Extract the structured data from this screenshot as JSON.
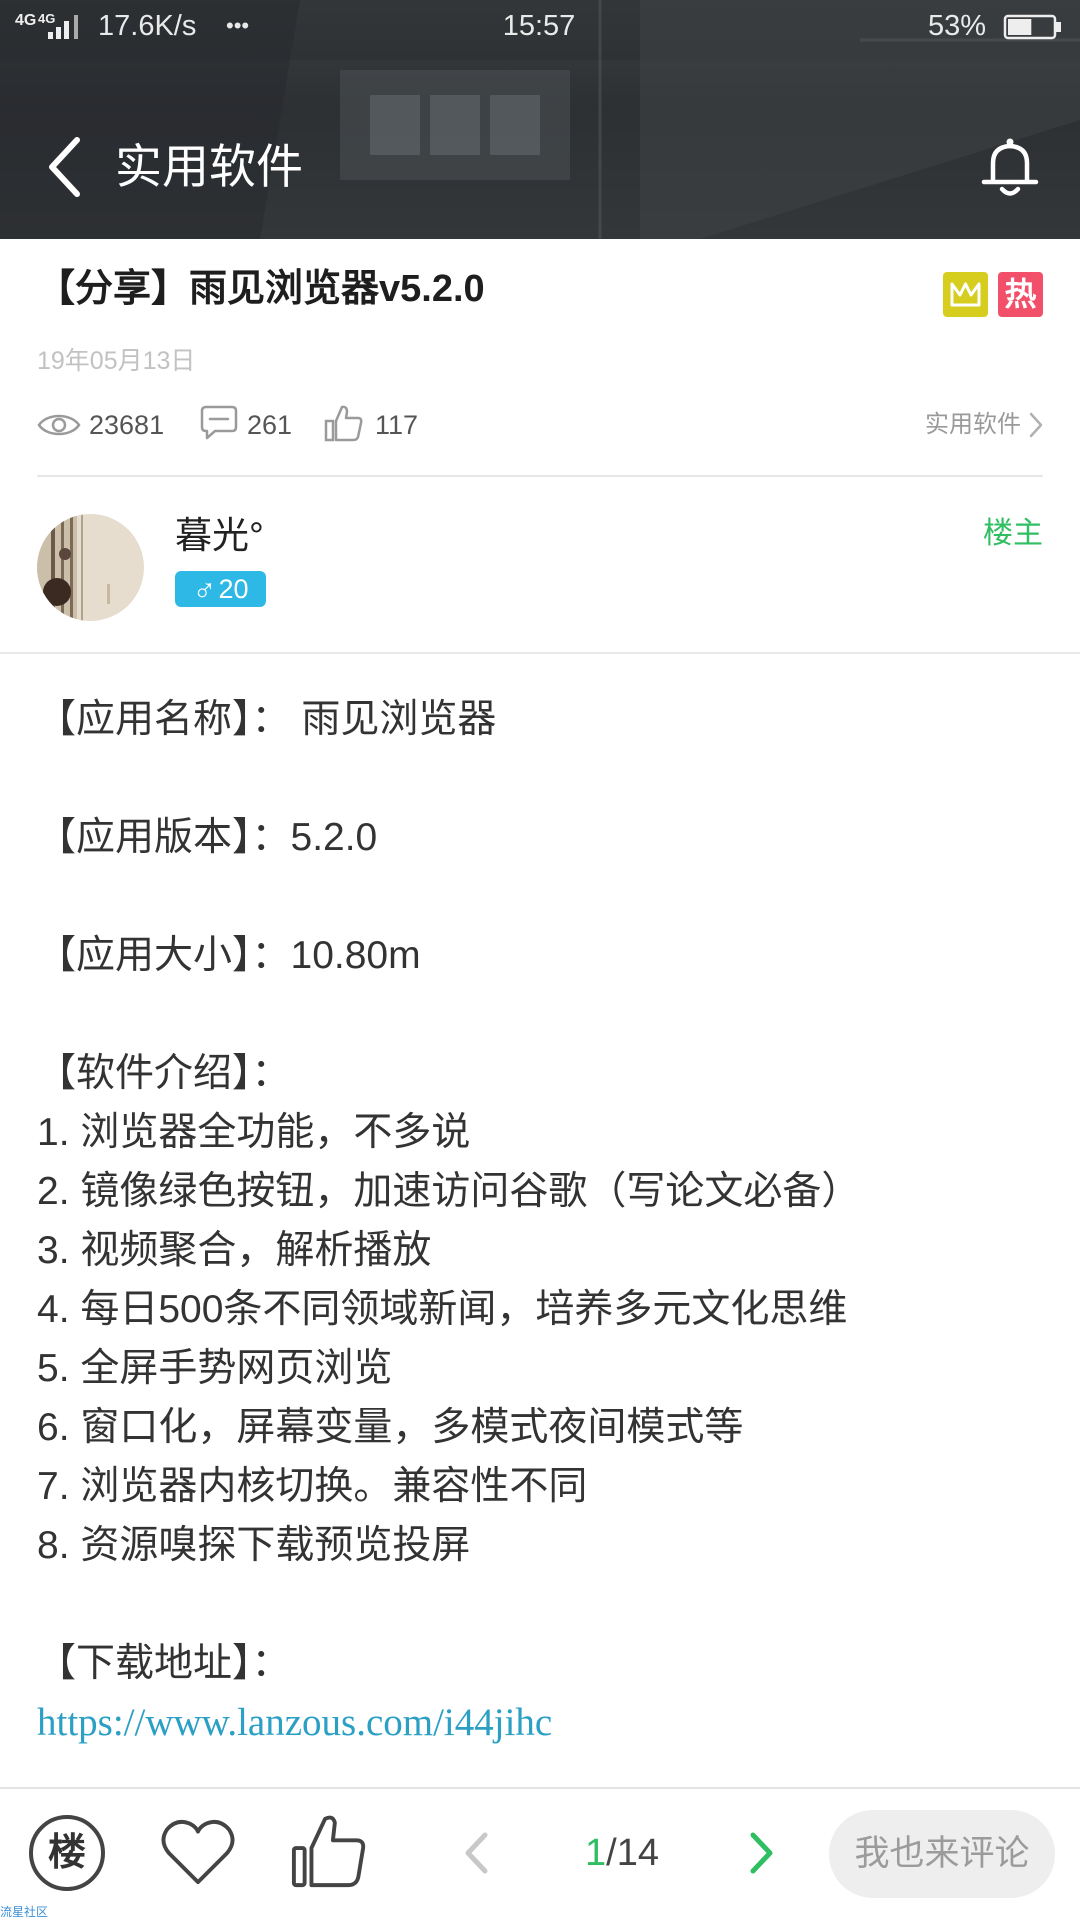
{
  "theme": {
    "accent_green": "#2fbf62",
    "link": "#2b9fc4",
    "gender_badge": "#2eb8e6",
    "hot_badge": "#f2506a",
    "crown_badge": "#d6cd1e"
  },
  "status_bar": {
    "network_1": "4G",
    "network_2": "4G",
    "speed": "17.6K/s",
    "dots": "•••",
    "time": "15:57",
    "battery": "53%",
    "battery_level": 0.53
  },
  "header": {
    "title": "实用软件",
    "back_icon": "chevron-left-icon",
    "bell_icon": "bell-icon"
  },
  "post": {
    "title": "【分享】雨见浏览器v5.2.0",
    "badge_crown_icon": "crown-icon",
    "badge_hot": "热",
    "date": "19年05月13日",
    "stats": {
      "views": "23681",
      "comments": "261",
      "likes": "117"
    },
    "category": "实用软件"
  },
  "author": {
    "name": "暮光°",
    "gender_symbol": "♂",
    "level": "20",
    "role": "楼主"
  },
  "content": {
    "app_name": "【应用名称】： 雨见浏览器",
    "app_version": "【应用版本】：5.2.0",
    "app_size": "【应用大小】：10.80m",
    "intro_heading": "【软件介绍】：",
    "intro_items": [
      "1. 浏览器全功能，不多说",
      "2. 镜像绿色按钮，加速访问谷歌（写论文必备）",
      "3. 视频聚合，解析播放",
      "4. 每日500条不同领域新闻，培养多元文化思维",
      "5. 全屏手势网页浏览",
      "6. 窗口化，屏幕变量，多模式夜间模式等",
      "7. 浏览器内核切换。兼容性不同",
      "8. 资源嗅探下载预览投屏"
    ],
    "download_heading": "【下载地址】：",
    "download_url": "https://www.lanzous.com/i44jihc"
  },
  "bottom_bar": {
    "floor_label": "楼",
    "page_current": "1",
    "page_total": "/14",
    "comment_placeholder": "我也来评论"
  },
  "watermark": "流星社区"
}
